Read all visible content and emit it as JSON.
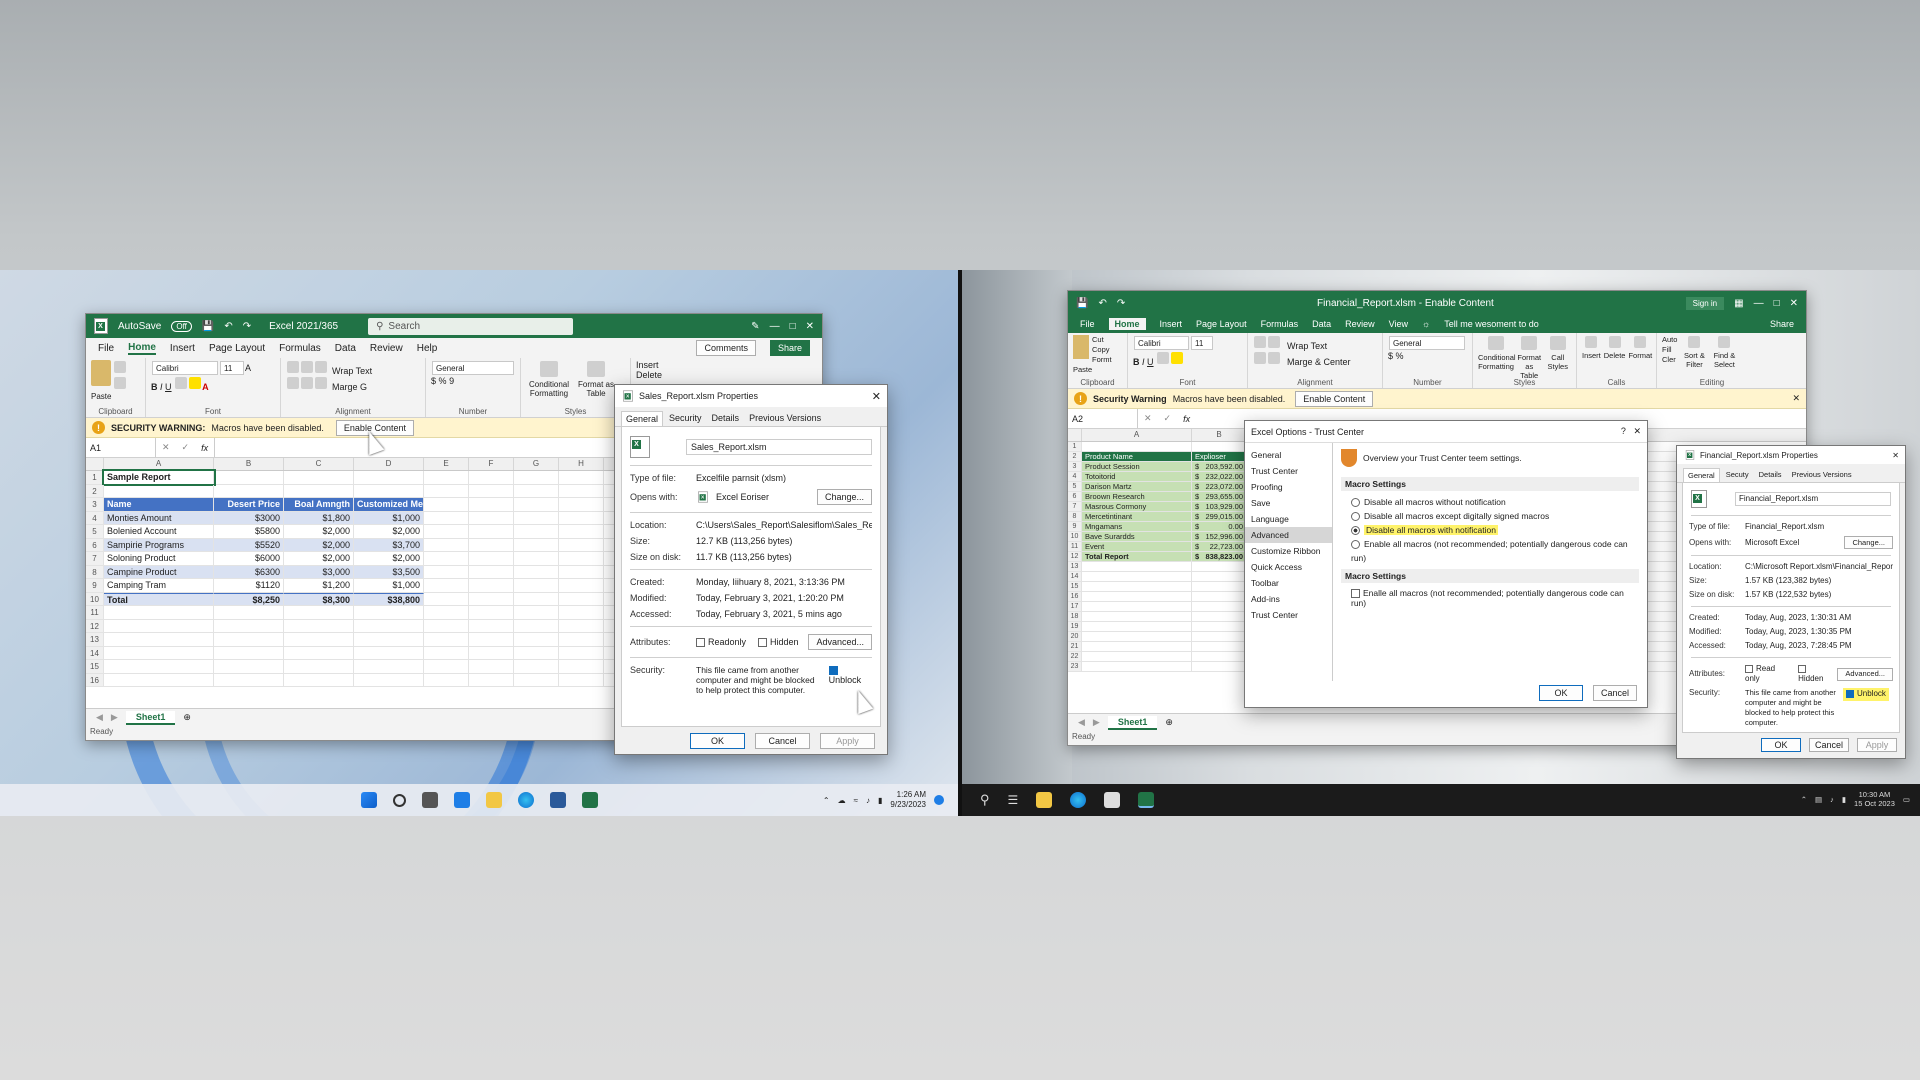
{
  "left": {
    "excel": {
      "autosave": "AutoSave",
      "toggle": "Off",
      "title": "Excel 2021/365",
      "search_placeholder": "Search",
      "menu": [
        "File",
        "Home",
        "Insert",
        "Page Layout",
        "Formulas",
        "Data",
        "Review",
        "Help"
      ],
      "comments": "Comments",
      "share": "Share",
      "ribbon": {
        "paste": "Paste",
        "font": "Calibri",
        "size": "11",
        "wrap": "Wrap Text",
        "merge": "Marge G",
        "number_format": "General",
        "cond": "Conditional Formatting",
        "fmt_table": "Format as Table",
        "insert": "Insert",
        "delete": "Delete",
        "groups": [
          "Clipboard",
          "Font",
          "Alignment",
          "Number",
          "Styles"
        ]
      },
      "warning": {
        "label": "SECURITY WARNING:",
        "text": "Macros have been disabled.",
        "button": "Enable Content"
      },
      "namebox": "A1",
      "fx": "fx",
      "columns": [
        "A",
        "B",
        "C",
        "D",
        "E",
        "F",
        "G",
        "H"
      ],
      "title_cell": "Sample Report",
      "headers": [
        "Name",
        "Desert Price",
        "Boal Amngth",
        "Customized Mength"
      ],
      "rows": [
        [
          "Monties Amount",
          "$3000",
          "$1,800",
          "$1,000"
        ],
        [
          "Bolenied Account",
          "$5800",
          "$2,000",
          "$2,000"
        ],
        [
          "Sampirie Programs",
          "$5520",
          "$2,000",
          "$3,700"
        ],
        [
          "Soloning Product",
          "$6000",
          "$2,000",
          "$2,000"
        ],
        [
          "Campine Product",
          "$6300",
          "$3,000",
          "$3,500"
        ],
        [
          "Camping Tram",
          "$1120",
          "$1,200",
          "$1,000"
        ]
      ],
      "total": [
        "Total",
        "$8,250",
        "$8,300",
        "$38,800"
      ],
      "sheet": "Sheet1",
      "status": "Ready"
    },
    "props": {
      "title": "Sales_Report.xlsm Properties",
      "tabs": [
        "General",
        "Security",
        "Details",
        "Previous Versions"
      ],
      "filename": "Sales_Report.xlsm",
      "type_label": "Type of file:",
      "type": "Excelfile parnsit (xlsm)",
      "opens_label": "Opens with:",
      "opens": "Excel Eoriser",
      "change": "Change...",
      "loc_label": "Location:",
      "loc": "C:\\Users\\Sales_Report\\Salesiflom\\Sales_Report.xl",
      "size_label": "Size:",
      "size": "12.7 KB (113,256 bytes)",
      "disk_label": "Size on disk:",
      "disk": "11.7 KB (113,256 bytes)",
      "created_label": "Created:",
      "created": "Monday, Iiihuary 8, 2021, 3:13:36 PM",
      "modified_label": "Modified:",
      "modified": "Today, February 3, 2021, 1:20:20 PM",
      "accessed_label": "Accessed:",
      "accessed": "Today, February 3, 2021, 5 mins ago",
      "attr_label": "Attributes:",
      "readonly": "Readonly",
      "hidden": "Hidden",
      "advanced": "Advanced...",
      "sec_label": "Security:",
      "sec_text": "This file came from another computer and might be blocked to help protect this computer.",
      "unblock": "Unblock",
      "ok": "OK",
      "cancel": "Cancel",
      "apply": "Apply"
    },
    "clock": {
      "time": "1:26 AM",
      "date": "9/23/2023"
    }
  },
  "right": {
    "excel": {
      "title": "Financial_Report.xlsm - Enable Content",
      "signin": "Sign in",
      "menu": [
        "File",
        "Home",
        "Insert",
        "Page Layout",
        "Formulas",
        "Data",
        "Review",
        "View"
      ],
      "tell": "Tell me wesoment to do",
      "share": "Share",
      "ribbon": {
        "cut": "Cut",
        "copy": "Copy",
        "format": "Formt",
        "paste": "Paste",
        "font": "Calibri",
        "size": "11",
        "wrap": "Wrap Text",
        "merge": "Marge & Center",
        "number_format": "General",
        "cond": "Conditional Formatting",
        "fmt_table": "Format as Table",
        "cell_styles": "Call Styles",
        "insert": "Insert",
        "delete": "Delete",
        "format2": "Format",
        "sum": "Auto",
        "fill": "Fill",
        "clear": "Cler",
        "sort": "Sort & Filter",
        "find": "Find & Select",
        "groups": [
          "Clipboard",
          "Font",
          "Alignment",
          "Number",
          "Styles",
          "Calls",
          "Editing"
        ]
      },
      "warning": {
        "label": "Security Warning",
        "text": "Macros have been disabled.",
        "button": "Enable Content"
      },
      "namebox": "A2",
      "fx": "fx",
      "columns": [
        "A",
        "B"
      ],
      "headers": [
        "Product Name",
        "Explioser"
      ],
      "rows": [
        [
          "Product Session",
          "$",
          "203,592.00"
        ],
        [
          "Totoitorid",
          "$",
          "232,022.00"
        ],
        [
          "Darison Martz",
          "$",
          "223,072.00"
        ],
        [
          "Broown Research",
          "$",
          "293,655.00"
        ],
        [
          "Masrous Cormony",
          "$",
          "103,929.00"
        ],
        [
          "Mercetintinant",
          "$",
          "299,015.00"
        ],
        [
          "Mngamans",
          "$",
          "0.00"
        ],
        [
          "Bave Surardds",
          "$",
          "152,996.00"
        ],
        [
          "Event",
          "$",
          "22,723.00"
        ],
        [
          "Total Report",
          "$",
          "838,823.00"
        ]
      ],
      "sheet": "Sheet1",
      "status": "Ready"
    },
    "trust": {
      "title": "Excel Options - Trust Center",
      "nav": [
        "General",
        "Trust Center",
        "Proofing",
        "Save",
        "Language",
        "Advanced",
        "Customize Ribbon",
        "Quick Access Toolbar",
        "Add-ins",
        "Trust Center"
      ],
      "overview": "Overview your Trust Center teem settings.",
      "section1": "Macro Settings",
      "options": [
        "Disable all macros without notification",
        "Disable all macros except digitally signed macros",
        "Disable all macros with notification",
        "Enable all macros (not recommended; potentially dangerous code can run)"
      ],
      "section2": "Macro Settings",
      "enable_opt": "Enalle all macros (not recommended; potentially dangerous code can run)",
      "ok": "OK",
      "cancel": "Cancel"
    },
    "props": {
      "title": "Financial_Report.xlsm Properties",
      "tabs": [
        "General",
        "Secuty",
        "Details",
        "Previous Versions"
      ],
      "filename": "Financial_Report.xlsm",
      "type_label": "Type of file:",
      "type": "Financial_Report.xlsm",
      "opens_label": "Opens with:",
      "opens": "Microsoft Excel",
      "change": "Change...",
      "loc_label": "Location:",
      "loc": "C:\\Microsoft Report.xlsm\\Financial_Report",
      "size_label": "Size:",
      "size": "1.57 KB (123,382 bytes)",
      "disk_label": "Size on disk:",
      "disk": "1.57 KB (122,532 bytes)",
      "created_label": "Created:",
      "created": "Today, Aug, 2023, 1:30:31 AM",
      "modified_label": "Modified:",
      "modified": "Today, Aug, 2023, 1:30:35 PM",
      "accessed_label": "Accessed:",
      "accessed": "Today, Aug, 2023, 7:28:45 PM",
      "attr_label": "Attributes:",
      "readonly": "Read only",
      "hidden": "Hidden",
      "advanced": "Advanced...",
      "sec_label": "Security:",
      "sec_text": "This file came from another computer and might be blocked to help protect this computer.",
      "unblock": "Unblock",
      "ok": "OK",
      "cancel": "Cancel",
      "apply": "Apply"
    },
    "clock": {
      "time": "10:30 AM",
      "date": "15 Oct 2023"
    }
  },
  "colors": {
    "excel_green": "#217346",
    "warning_bg": "#fff4ce",
    "highlight": "#fff36a",
    "table_header": "#4472c4",
    "table_band": "#d9e1f2",
    "green_band": "#c6e0b4"
  }
}
